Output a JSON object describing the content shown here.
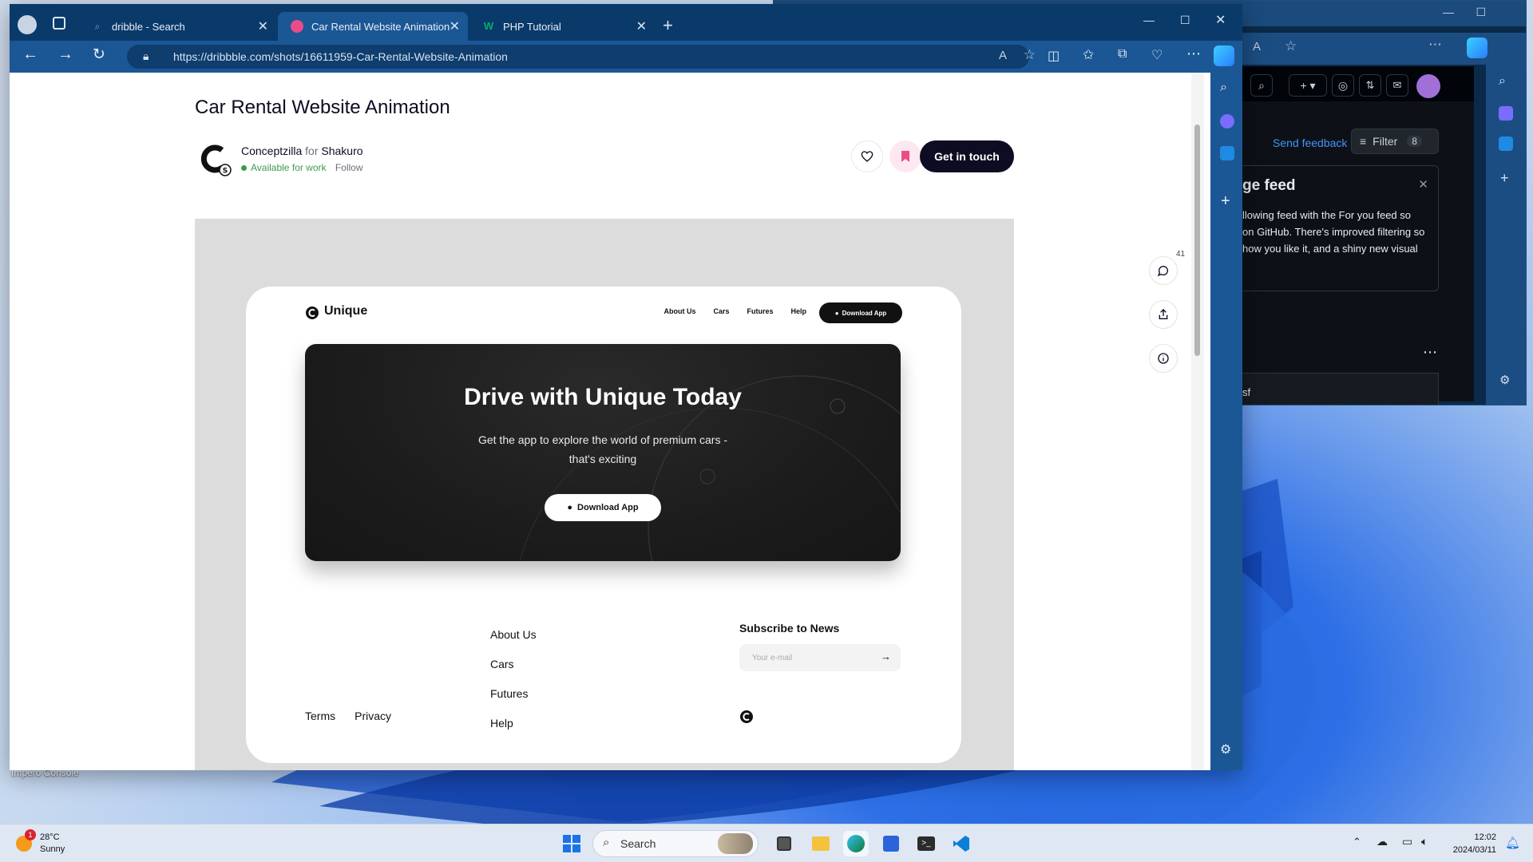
{
  "browser": {
    "tabs": [
      {
        "label": "dribble - Search",
        "favicon": "search-icon"
      },
      {
        "label": "Car Rental Website Animation by",
        "favicon": "dribbble-icon",
        "active": true
      },
      {
        "label": "PHP Tutorial",
        "favicon": "w3schools-icon"
      }
    ],
    "url": "https://dribbble.com/shots/16611959-Car-Rental-Website-Animation"
  },
  "shot": {
    "title": "Car Rental Website Animation",
    "author": "Conceptzilla",
    "for_word": "for",
    "team": "Shakuro",
    "availability": "Available for work",
    "follow": "Follow",
    "cta": "Get in touch",
    "comments_count": "41"
  },
  "mock": {
    "brand": "Unique",
    "nav": [
      "About Us",
      "Cars",
      "Futures",
      "Help"
    ],
    "nav_download": "Download App",
    "hero_title": "Drive with Unique Today",
    "hero_sub": "Get the app to explore the world of premium cars - that's exciting",
    "hero_button": "Download App",
    "footer_links": [
      "About Us",
      "Cars",
      "Futures",
      "Help"
    ],
    "footer_bottom": [
      "Terms",
      "Privacy"
    ],
    "subscribe_title": "Subscribe to News",
    "email_placeholder": "Your e-mail"
  },
  "back_window": {
    "send_feedback": "Send feedback",
    "filter": "Filter",
    "filter_count": "8",
    "feed_title": "ge feed",
    "feed_text_1": "llowing feed with the For you feed so",
    "feed_text_2": "on GitHub. There's improved filtering so",
    "feed_text_3": "how you like it, and a shiny new visual",
    "bottom_text": "sf"
  },
  "desktop": {
    "icon_label": "Impero Console"
  },
  "taskbar": {
    "weather_temp": "28°C",
    "weather_desc": "Sunny",
    "weather_badge": "1",
    "search": "Search",
    "time": "12:02",
    "date": "2024/03/11"
  },
  "colors": {
    "dribbble_dark": "#0d0c22",
    "available_green": "#3d9a4d",
    "edge_blue": "#1b5795",
    "bookmark_pink": "#ea4c89"
  }
}
